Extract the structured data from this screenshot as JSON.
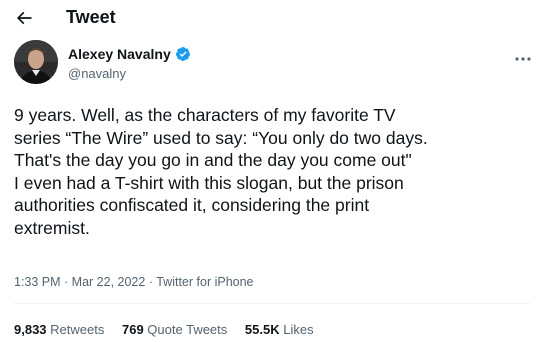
{
  "header": {
    "title": "Tweet",
    "back_icon": "arrow-left-icon"
  },
  "author": {
    "name": "Alexey Navalny",
    "handle": "@navalny",
    "verified_icon": "verified-badge-icon",
    "verified_color": "#1d9bf0",
    "more_icon": "more-horizontal-icon"
  },
  "tweet": {
    "lines": [
      "9 years. Well, as the characters of my favorite TV",
      "series “The Wire” used to say: “You only do two days.",
      "That's the day you go in and the day you come out\"",
      "I even had a T-shirt with this slogan, but the prison",
      "authorities confiscated it, considering the print",
      "extremist."
    ]
  },
  "meta": {
    "time": "1:33 PM",
    "separator": " · ",
    "date": "Mar 22, 2022",
    "source": "Twitter for iPhone"
  },
  "stats": {
    "retweets_count": "9,833",
    "retweets_label": " Retweets",
    "quotes_count": "769",
    "quotes_label": " Quote Tweets",
    "likes_count": "55.5K",
    "likes_label": " Likes"
  },
  "colors": {
    "text_primary": "#0f1419",
    "text_secondary": "#536471",
    "divider": "#eff3f4",
    "accent": "#1d9bf0"
  }
}
